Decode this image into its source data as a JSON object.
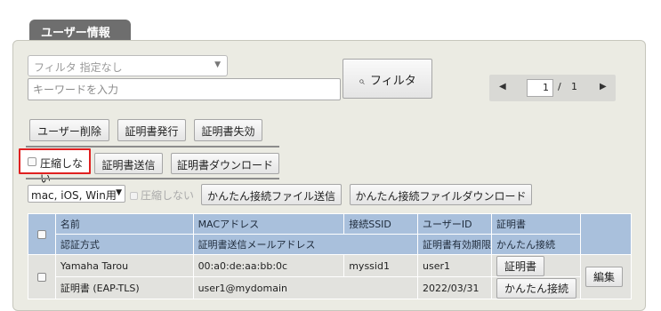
{
  "tab_title": "ユーザー情報",
  "filter": {
    "select_value": "フィルタ 指定なし",
    "keyword_placeholder": "キーワードを入力",
    "button_label": "フィルタ",
    "search_icon": "⌕"
  },
  "pager": {
    "prev_icon": "◀",
    "next_icon": "▶",
    "current_page": "1",
    "separator": "/",
    "total_pages": "1"
  },
  "actions_row1": {
    "delete_user": "ユーザー削除",
    "issue_cert": "証明書発行",
    "revoke_cert": "証明書失効"
  },
  "actions_row2": {
    "compress_label": "圧縮しない",
    "send_cert": "証明書送信",
    "download_cert": "証明書ダウンロード"
  },
  "actions_row3": {
    "os_select_value": "mac, iOS, Win用",
    "compress_label": "圧縮しない",
    "send_easy_file": "かんたん接続ファイル送信",
    "download_easy_file": "かんたん接続ファイルダウンロード"
  },
  "table": {
    "headers_row1": [
      "名前",
      "MACアドレス",
      "接続SSID",
      "ユーザーID",
      "証明書"
    ],
    "headers_row2": [
      "認証方式",
      "証明書送信メールアドレス",
      "証明書有効期限",
      "かんたん接続"
    ],
    "rows": [
      {
        "name": "Yamaha Tarou",
        "mac": "00:a0:de:aa:bb:0c",
        "ssid": "myssid1",
        "user_id": "user1",
        "cert_button": "証明書",
        "auth": "証明書 (EAP-TLS)",
        "email": "user1@mydomain",
        "expiry": "2022/03/31",
        "easy_button": "かんたん接続",
        "edit_button": "編集"
      }
    ]
  }
}
